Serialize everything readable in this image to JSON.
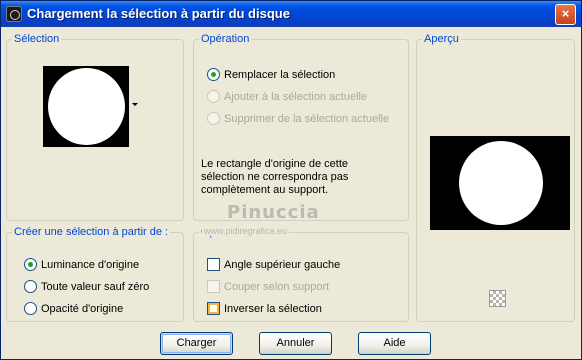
{
  "window": {
    "title": "Chargement la sélection à partir du disque",
    "close_glyph": "×"
  },
  "selection_group": {
    "legend": "Sélection"
  },
  "operation_group": {
    "legend": "Opération",
    "options": [
      {
        "label": "Remplacer la sélection",
        "checked": true,
        "enabled": true
      },
      {
        "label": "Ajouter à la sélection actuelle",
        "checked": false,
        "enabled": false
      },
      {
        "label": "Supprimer de la sélection actuelle",
        "checked": false,
        "enabled": false
      }
    ],
    "message": "Le rectangle d'origine de cette sélection ne correspondra pas complètement au support."
  },
  "preview_group": {
    "legend": "Aperçu"
  },
  "create_group": {
    "legend": "Créer une sélection à partir de :",
    "options": [
      {
        "label": "Luminance d'origine",
        "checked": true
      },
      {
        "label": "Toute valeur sauf zéro",
        "checked": false
      },
      {
        "label": "Opacité d'origine",
        "checked": false
      }
    ]
  },
  "options_group": {
    "legend": "Options",
    "checks": [
      {
        "label": "Angle supérieur gauche",
        "checked": false,
        "enabled": true
      },
      {
        "label": "Couper selon support",
        "checked": false,
        "enabled": false
      },
      {
        "label": "Inverser la sélection",
        "checked": false,
        "enabled": true
      }
    ]
  },
  "watermark": {
    "line1": "Pinuccia",
    "line2": "www.pidiregrafica.eu"
  },
  "buttons": {
    "load": "Charger",
    "cancel": "Annuler",
    "help": "Aide"
  }
}
